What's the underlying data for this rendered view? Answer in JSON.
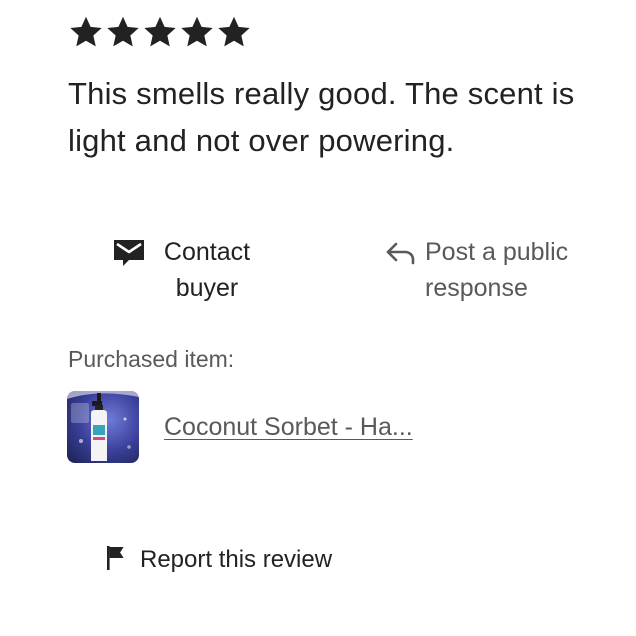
{
  "review": {
    "rating": 5,
    "max_rating": 5,
    "text": "This smells really good. The scent is light and not over powering."
  },
  "actions": {
    "contact_label": "Contact buyer",
    "response_label": "Post a public response",
    "contact_icon": "mail-icon",
    "response_icon": "reply-arrow-icon"
  },
  "purchased": {
    "label": "Purchased item:",
    "item_title": "Coconut Sorbet - Ha..."
  },
  "report": {
    "label": "Report this review",
    "icon": "flag-icon"
  },
  "colors": {
    "primary_text": "#222222",
    "secondary_text": "#595959",
    "background": "#ffffff"
  }
}
